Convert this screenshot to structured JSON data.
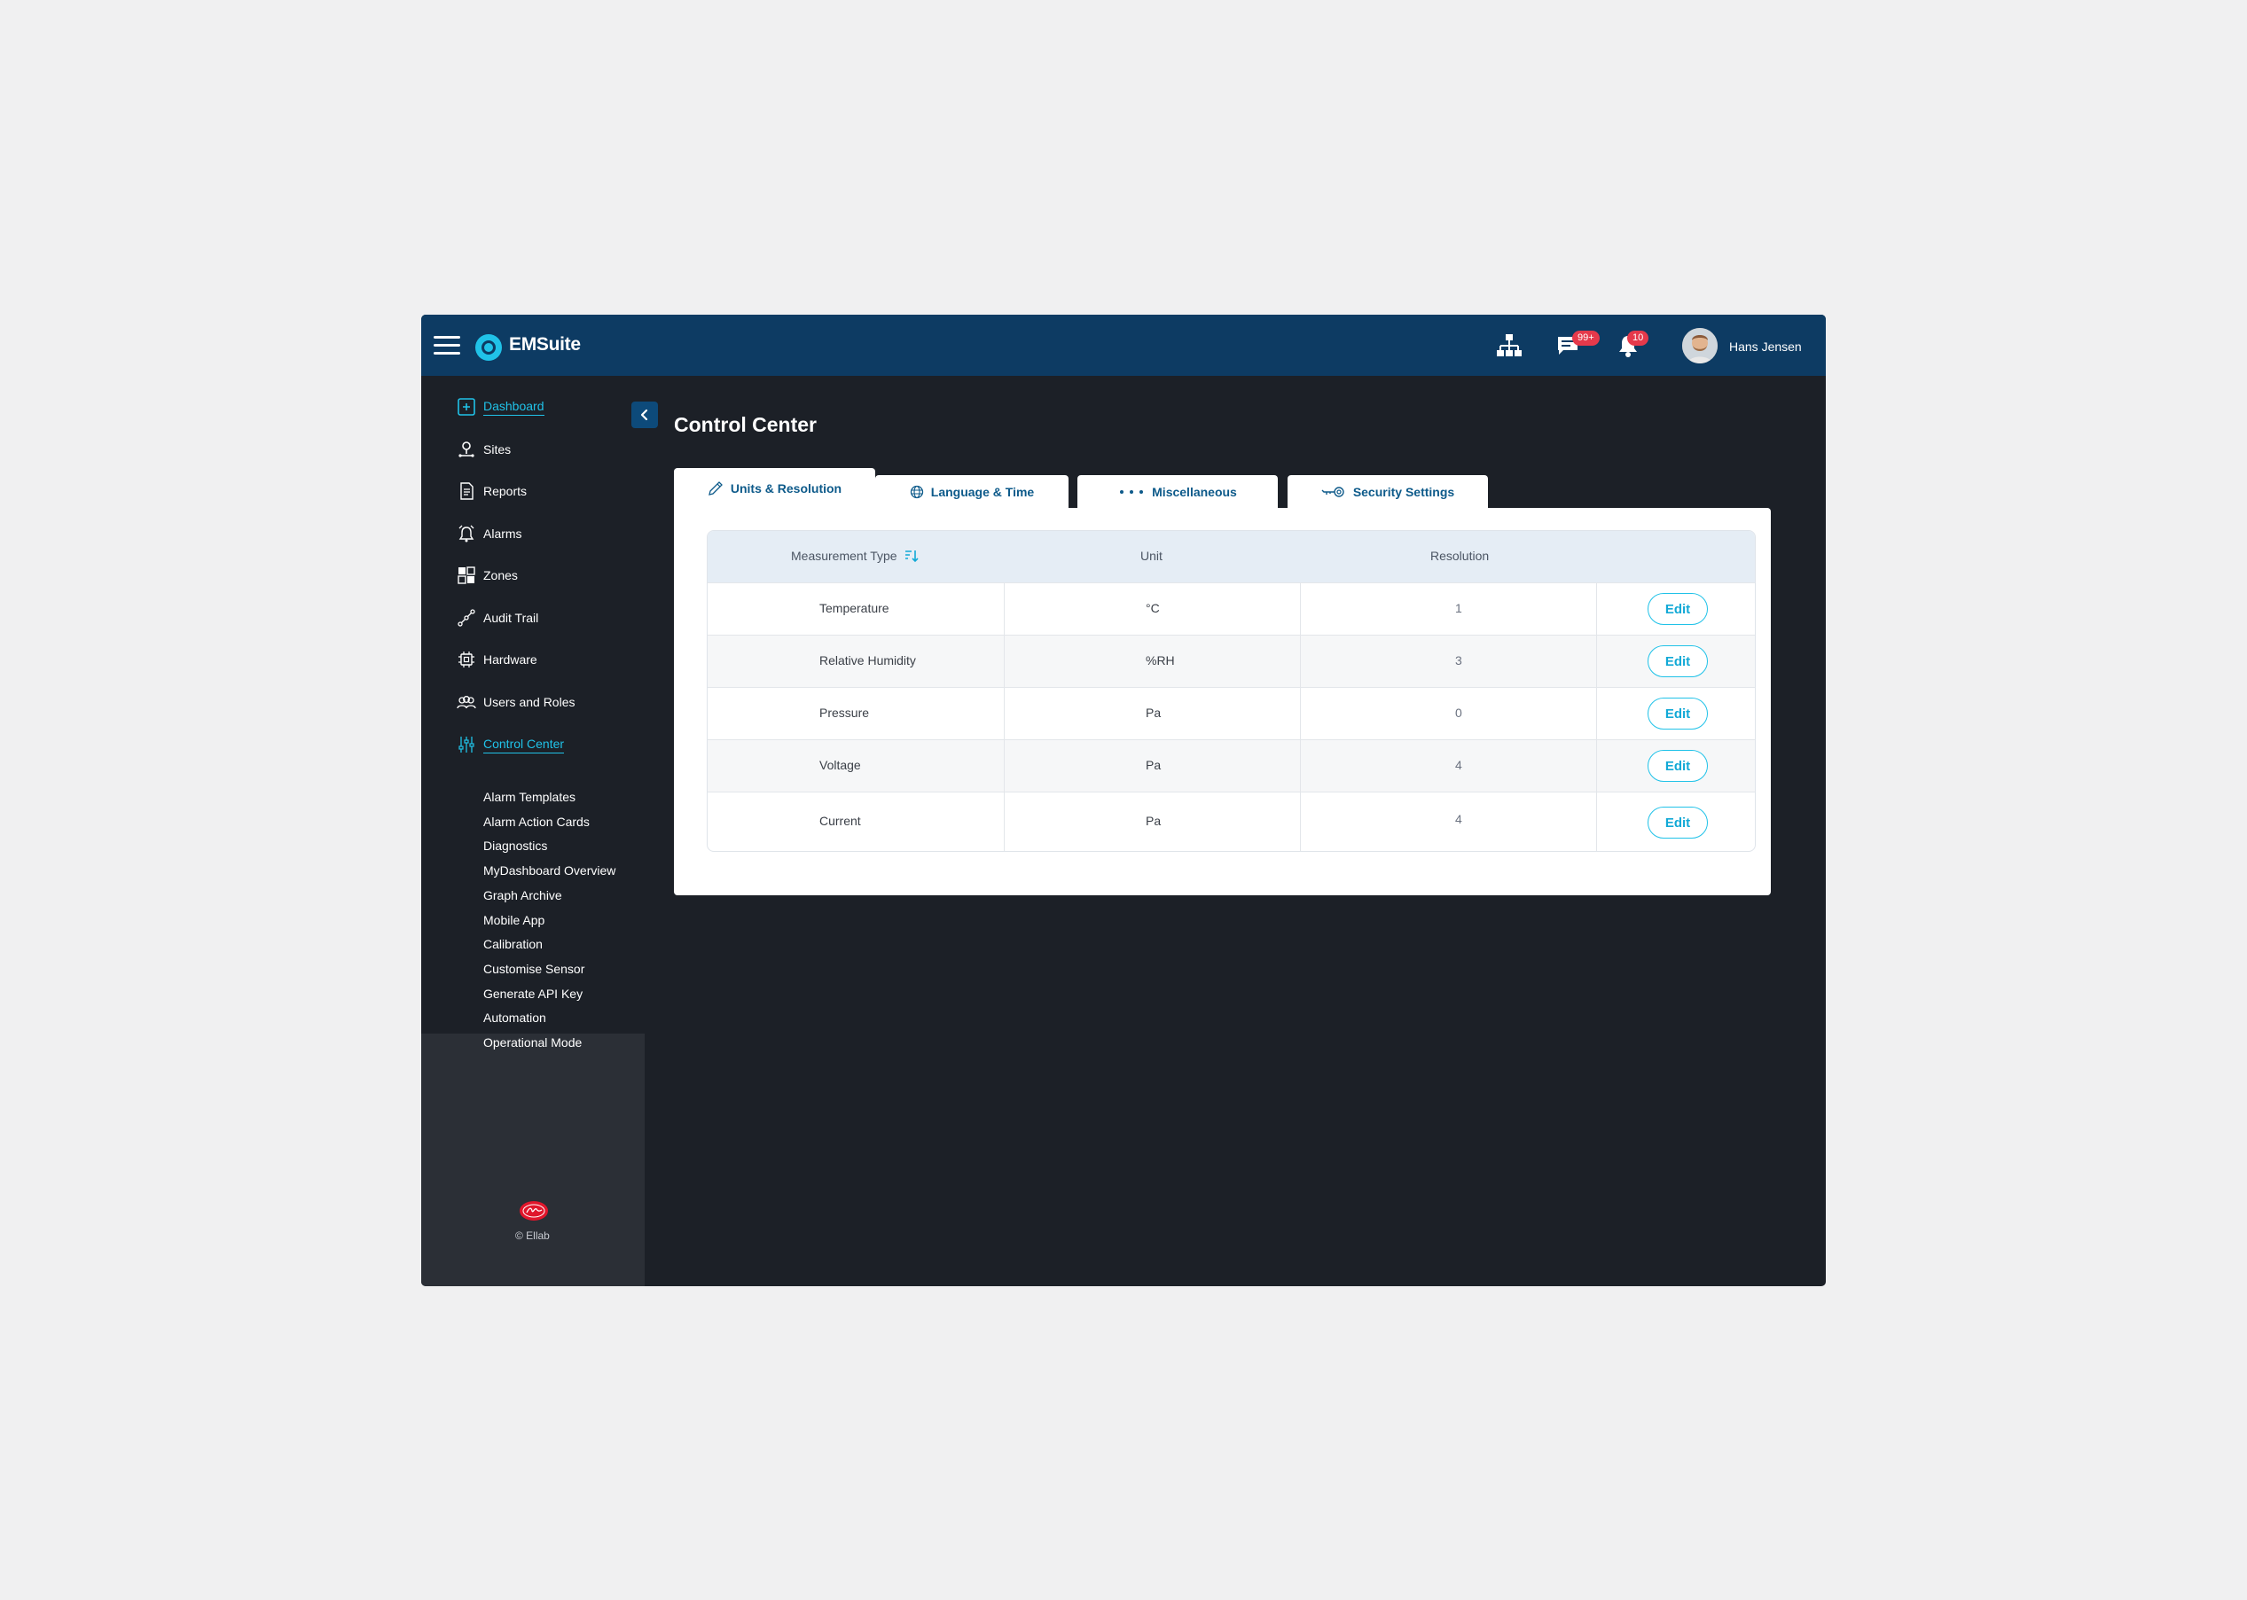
{
  "app": {
    "title": "EMSuite"
  },
  "header": {
    "messages_badge": "99+",
    "notifications_badge": "10",
    "user_name": "Hans Jensen"
  },
  "sidebar": {
    "items": [
      {
        "label": "Dashboard",
        "icon": "dashboard-icon",
        "active": true
      },
      {
        "label": "Sites",
        "icon": "sites-icon"
      },
      {
        "label": "Reports",
        "icon": "reports-icon"
      },
      {
        "label": "Alarms",
        "icon": "alarm-icon"
      },
      {
        "label": "Zones",
        "icon": "zones-icon"
      },
      {
        "label": "Audit Trail",
        "icon": "audit-trail-icon"
      },
      {
        "label": "Hardware",
        "icon": "hardware-icon"
      },
      {
        "label": "Users and Roles",
        "icon": "users-icon"
      },
      {
        "label": "Control Center",
        "icon": "control-center-icon",
        "active": true
      }
    ],
    "submenu": [
      "Alarm Templates",
      "Alarm Action Cards",
      "Diagnostics",
      "MyDashboard Overview",
      "Graph Archive",
      "Mobile App",
      "Calibration",
      "Customise Sensor",
      "Generate API Key",
      "Automation",
      "Operational Mode"
    ],
    "copyright": "© Ellab"
  },
  "main": {
    "title": "Control Center",
    "tabs": [
      {
        "label": "Units & Resolution",
        "icon": "pencil-icon",
        "active": true
      },
      {
        "label": "Language & Time",
        "icon": "globe-icon"
      },
      {
        "label": "Miscellaneous",
        "icon": "dots-icon"
      },
      {
        "label": "Security Settings",
        "icon": "key-icon"
      }
    ],
    "table": {
      "headers": [
        "Measurement Type",
        "Unit",
        "Resolution"
      ],
      "rows": [
        {
          "type": "Temperature",
          "unit": "°C",
          "resolution": "1",
          "action": "Edit"
        },
        {
          "type": "Relative Humidity",
          "unit": "%RH",
          "resolution": "3",
          "action": "Edit"
        },
        {
          "type": "Pressure",
          "unit": "Pa",
          "resolution": "0",
          "action": "Edit"
        },
        {
          "type": "Voltage",
          "unit": "Pa",
          "resolution": "4",
          "action": "Edit"
        },
        {
          "type": "Current",
          "unit": "Pa",
          "resolution": "4",
          "action": "Edit"
        }
      ]
    }
  },
  "colors": {
    "header": "#0d3b63",
    "background": "#1c2027",
    "accent": "#20c2e8",
    "badge": "#e5394b"
  }
}
